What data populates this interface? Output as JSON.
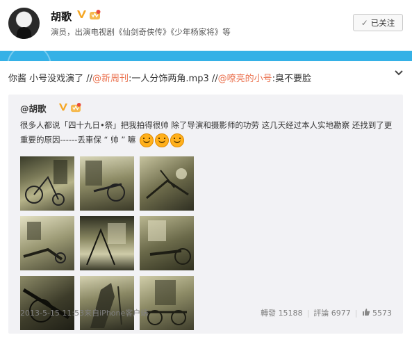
{
  "header": {
    "name": "胡歌",
    "description": "演员，出演电视剧《仙剑奇侠传》《少年杨家将》等",
    "follow_label": "已关注"
  },
  "post": {
    "text_1": "你酱 小号没戏演了 //",
    "mention_1": "@新周刊",
    "text_2": ":一人分饰两角.mp3 //",
    "mention_2": "@嘹亮的小号",
    "text_3": ":臭不要脸"
  },
  "repost": {
    "author": "@胡歌",
    "text_1": "很多人都说「四十九日•祭」把我拍得很帅 除了导演和摄影师的功劳 这几天经过本人实地勘察 还找到了更重要的原因------丢車保 “ 帅 ” 嘛",
    "time": "2013-5-15 11:53",
    "source": "来自iPhone客户端",
    "forward_label": "轉發",
    "forward_count": "15188",
    "comment_label": "評論",
    "comment_count": "6977",
    "like_count": "5573"
  },
  "icons": {
    "verified": "verified-v-icon",
    "vip": "vip-crown-icon",
    "chevron": "chevron-down-icon",
    "like": "thumbs-up-icon",
    "check": "check-icon",
    "emoji": "smile-emoji-icon"
  },
  "colors": {
    "mention": "#eb7350",
    "bar": "#35b1e6",
    "repost_bg": "#f2f2f5",
    "verified": "#f5a623"
  }
}
